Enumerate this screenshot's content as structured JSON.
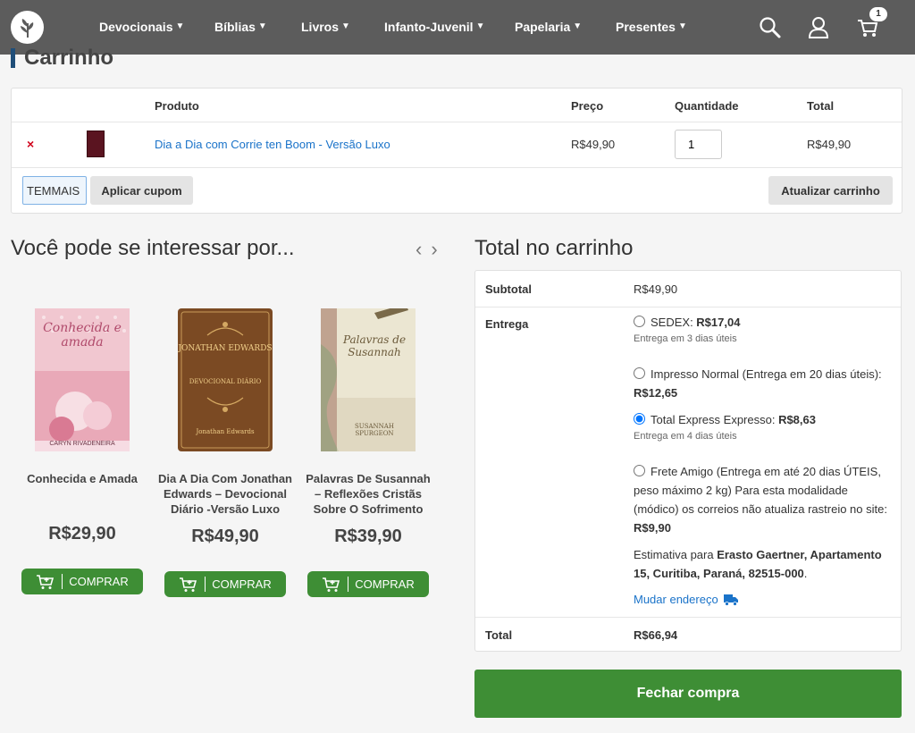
{
  "header": {
    "nav": [
      {
        "label": "Devocionais"
      },
      {
        "label": "Bíblias"
      },
      {
        "label": "Livros"
      },
      {
        "label": "Infanto-Juvenil"
      },
      {
        "label": "Papelaria"
      },
      {
        "label": "Presentes"
      }
    ],
    "cart_count": "1"
  },
  "page": {
    "title": "Carrinho"
  },
  "cart": {
    "columns": {
      "product": "Produto",
      "price": "Preço",
      "quantity": "Quantidade",
      "total": "Total"
    },
    "item": {
      "remove": "×",
      "name": "Dia a Dia com Corrie ten Boom - Versão Luxo",
      "price": "R$49,90",
      "quantity": "1",
      "total": "R$49,90"
    },
    "coupon_value": "TEMMAIS",
    "apply_coupon": "Aplicar cupom",
    "update_cart": "Atualizar carrinho"
  },
  "recommendations": {
    "title": "Você pode se interessar por...",
    "prev": "‹",
    "next": "›",
    "items": [
      {
        "name": "Conhecida e Amada",
        "price": "R$29,90",
        "buy": "COMPRAR",
        "cover_title": "Conhecida e amada",
        "cover_author": "CARYN RIVADENEIRA"
      },
      {
        "name": "Dia A Dia Com Jonathan Edwards – Devocional Diário -Versão Luxo",
        "price": "R$49,90",
        "buy": "COMPRAR",
        "cover_title": "JONATHAN EDWARDS",
        "cover_sub": "DEVOCIONAL DIÁRIO",
        "cover_author": "Jonathan Edwards"
      },
      {
        "name": "Palavras De Susannah – Reflexões Cristãs Sobre O Sofrimento",
        "price": "R$39,90",
        "buy": "COMPRAR",
        "cover_title": "Palavras de Susannah",
        "cover_author": "SUSANNAH SPURGEON"
      }
    ]
  },
  "totals": {
    "title": "Total no carrinho",
    "subtotal_label": "Subtotal",
    "subtotal_value": "R$49,90",
    "shipping_label": "Entrega",
    "shipping_options": [
      {
        "text": "SEDEX: ",
        "price": "R$17,04",
        "note": "Entrega em 3 dias úteis",
        "selected": false
      },
      {
        "text": "Impresso Normal (Entrega em 20 dias úteis): ",
        "price": "R$12,65",
        "note": "",
        "selected": false
      },
      {
        "text": "Total Express Expresso: ",
        "price": "R$8,63",
        "note": "Entrega em 4 dias úteis",
        "selected": true
      },
      {
        "text": "Frete Amigo (Entrega em até 20 dias ÚTEIS, peso máximo 2 kg) Para esta modalidade (módico) os correios não atualiza rastreio no site: ",
        "price": "R$9,90",
        "note": "",
        "selected": false
      }
    ],
    "estimate_prefix": "Estimativa para ",
    "estimate_address": "Erasto Gaertner, Apartamento 15, Curitiba, Paraná, 82515-000",
    "estimate_suffix": ".",
    "change_address": "Mudar endereço",
    "total_label": "Total",
    "total_value": "R$66,94",
    "checkout": "Fechar compra"
  }
}
